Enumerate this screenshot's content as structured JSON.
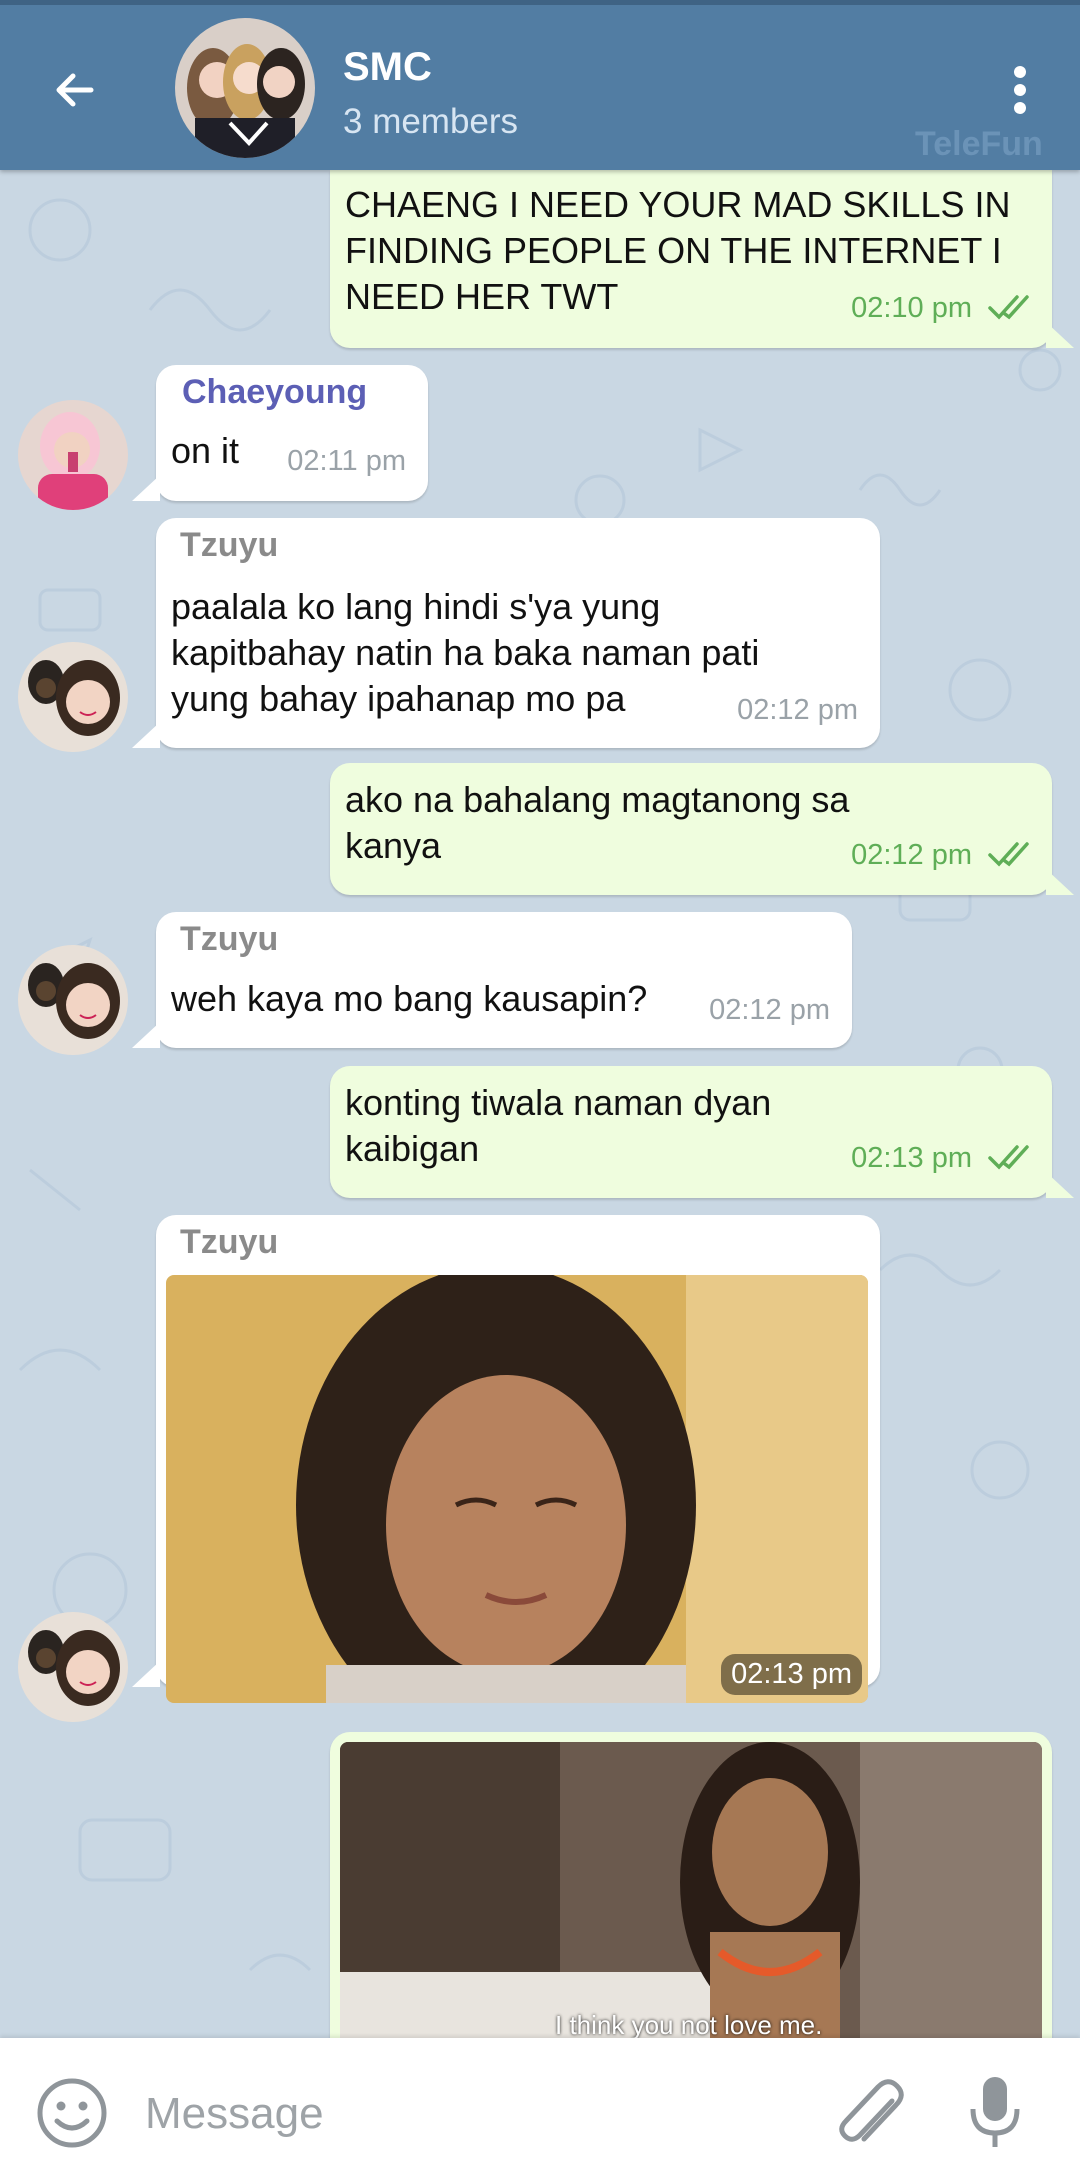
{
  "header": {
    "title": "SMC",
    "subtitle": "3 members",
    "watermark": "TeleFun"
  },
  "messages": [
    {
      "direction": "out",
      "text": "CHAENG I NEED YOUR MAD SKILLS IN\nFINDING PEOPLE ON THE INTERNET I\nNEED HER TWT",
      "time": "02:10 pm"
    },
    {
      "direction": "in",
      "sender": "Chaeyoung",
      "text": "on it",
      "time": "02:11 pm"
    },
    {
      "direction": "in",
      "sender": "Tzuyu",
      "text": "paalala ko lang hindi s'ya yung\nkapitbahay natin ha baka naman pati\nyung bahay ipahanap mo pa",
      "time": "02:12 pm"
    },
    {
      "direction": "out",
      "text": "ako na bahalang magtanong sa\nkanya",
      "time": "02:12 pm"
    },
    {
      "direction": "in",
      "sender": "Tzuyu",
      "text": "weh kaya mo bang kausapin?",
      "time": "02:12 pm"
    },
    {
      "direction": "out",
      "text": "konting tiwala naman dyan\nkaibigan",
      "time": "02:13 pm"
    },
    {
      "direction": "in",
      "sender": "Tzuyu",
      "type": "photo",
      "time": "02:13 pm"
    },
    {
      "direction": "out",
      "type": "photo",
      "caption": "I think you not love me."
    }
  ],
  "input": {
    "placeholder": "Message"
  },
  "colors": {
    "header": "#527da3",
    "incoming": "#ffffff",
    "outgoing": "#effdde",
    "chaeyoung_name": "#5c5fb5",
    "tzuyu_name": "#8a8a8a",
    "read_ticks": "#5fae57"
  },
  "icons": {
    "back": "arrow-left-icon",
    "menu": "more-vertical-icon",
    "emoji": "emoji-icon",
    "attach": "paperclip-icon",
    "mic": "microphone-icon"
  }
}
